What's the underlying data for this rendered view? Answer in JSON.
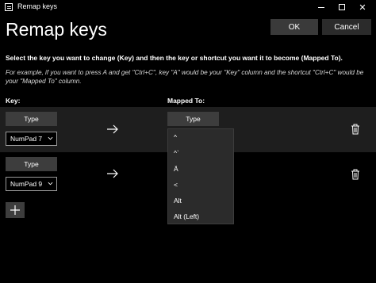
{
  "window": {
    "title": "Remap keys",
    "minimize_icon": "minimize-icon",
    "maximize_icon": "maximize-icon",
    "close_glyph": "✕"
  },
  "header": {
    "title": "Remap keys",
    "ok_label": "OK",
    "cancel_label": "Cancel"
  },
  "instructions": {
    "main": "Select the key you want to change (Key) and then the key or shortcut you want it to become (Mapped To).",
    "example": "For example, if you want to press A and get \"Ctrl+C\", key \"A\" would be your \"Key\" column and the shortcut \"Ctrl+C\" would be your \"Mapped To\" column."
  },
  "columns": {
    "key": "Key:",
    "mapped": "Mapped To:"
  },
  "rows": [
    {
      "type_label": "Type",
      "key_value": "NumPad 7",
      "mapped_type_label": "Type"
    },
    {
      "type_label": "Type",
      "key_value": "NumPad 9",
      "mapped_value": ""
    }
  ],
  "dropdown_menu": {
    "items": [
      "^",
      "^`",
      "Ä",
      "<",
      "Alt",
      "Alt (Left)"
    ]
  },
  "colors": {
    "background": "#000000",
    "row_highlight": "#1e1e1e",
    "button": "#3d3d3d",
    "menu": "#2b2b2b"
  }
}
